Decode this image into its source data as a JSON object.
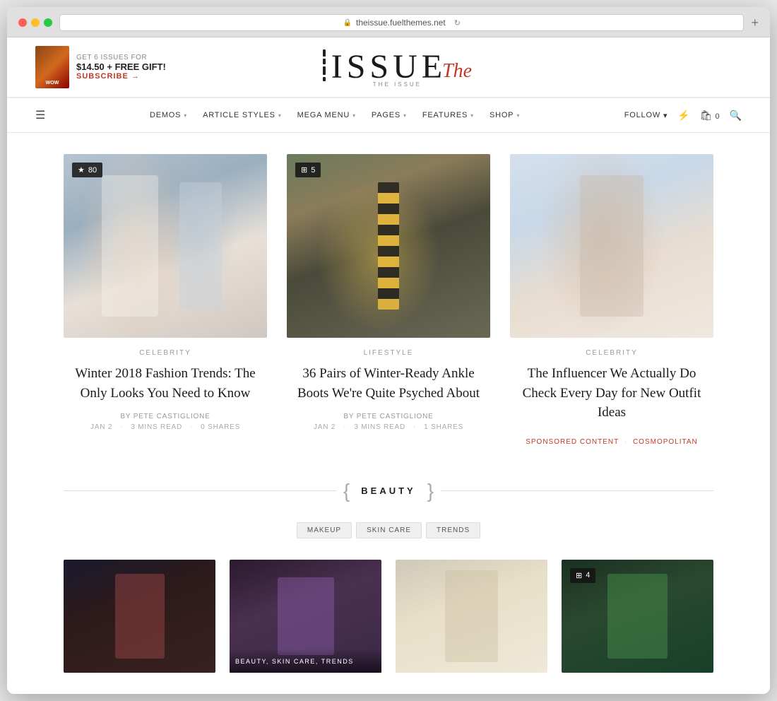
{
  "browser": {
    "url": "theissue.fuelthemes.net",
    "new_tab_label": "+"
  },
  "banner": {
    "get_issues": "GET 6 ISSUES FOR",
    "price": "$14.50 + FREE GIFT!",
    "subscribe": "SUBSCRIBE"
  },
  "logo": {
    "text": "ISSUE",
    "script": "The",
    "subtitle": "THE ISSUE"
  },
  "nav": {
    "links": [
      {
        "label": "DEMOS",
        "has_dropdown": true
      },
      {
        "label": "ARTICLE STYLES",
        "has_dropdown": true
      },
      {
        "label": "MEGA MENU",
        "has_dropdown": true
      },
      {
        "label": "PAGES",
        "has_dropdown": true
      },
      {
        "label": "FEATURES",
        "has_dropdown": true
      },
      {
        "label": "SHOP",
        "has_dropdown": true
      }
    ],
    "follow": "FOLLOW",
    "cart_count": "0"
  },
  "articles": [
    {
      "category": "CELEBRITY",
      "title": "Winter 2018 Fashion Trends: The Only Looks You Need to Know",
      "author": "BY PETE CASTIGLIONE",
      "date": "JAN 2",
      "read_time": "3 MINS READ",
      "shares": "0 SHARES",
      "badge_score": "80",
      "badge_icon": "★",
      "image_type": "fashion"
    },
    {
      "category": "LIFESTYLE",
      "title": "36 Pairs of Winter-Ready Ankle Boots We're Quite Psyched About",
      "author": "BY PETE CASTIGLIONE",
      "date": "JAN 2",
      "read_time": "3 MINS READ",
      "shares": "1 SHARES",
      "badge_score": "5",
      "badge_icon": "▦",
      "image_type": "boots"
    },
    {
      "category": "CELEBRITY",
      "title": "The Influencer We Actually Do Check Every Day for New Outfit Ideas",
      "author": "",
      "date": "",
      "read_time": "",
      "shares": "",
      "tag1": "SPONSORED CONTENT",
      "tag2": "COSMOPOLITAN",
      "image_type": "influencer"
    }
  ],
  "beauty_section": {
    "title": "BEAUTY",
    "tags": [
      "MAKEUP",
      "SKIN CARE",
      "TRENDS"
    ]
  },
  "bottom_cards": [
    {
      "image_type": "beauty1",
      "overlay_text": ""
    },
    {
      "image_type": "beauty2",
      "overlay_text": "BEAUTY, SKIN CARE, TRENDS"
    },
    {
      "image_type": "beauty3",
      "overlay_text": ""
    },
    {
      "image_type": "beauty4",
      "overlay_text": "",
      "badge_score": "4",
      "badge_icon": "▦"
    }
  ]
}
